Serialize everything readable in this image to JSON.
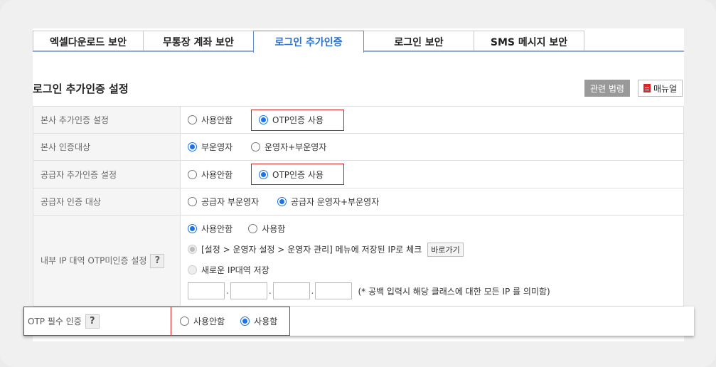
{
  "tabs": [
    {
      "label": "엑셀다운로드 보안",
      "active": false
    },
    {
      "label": "무통장 계좌 보안",
      "active": false
    },
    {
      "label": "로그인 추가인증",
      "active": true
    },
    {
      "label": "로그인 보안",
      "active": false
    },
    {
      "label": "SMS 메시지 보안",
      "active": false
    }
  ],
  "section_title": "로그인 추가인증 설정",
  "buttons": {
    "law": "관련 법령",
    "manual": "매뉴얼"
  },
  "rows": {
    "hq_auth": {
      "label": "본사 추가인증 설정",
      "opt1": "사용안함",
      "opt2": "OTP인증 사용",
      "selected": "opt2"
    },
    "hq_target": {
      "label": "본사 인증대상",
      "opt1": "부운영자",
      "opt2": "운영자+부운영자",
      "selected": "opt1"
    },
    "sup_auth": {
      "label": "공급자 추가인증 설정",
      "opt1": "사용안함",
      "opt2": "OTP인증 사용",
      "selected": "opt2"
    },
    "sup_target": {
      "label": "공급자 인증 대상",
      "opt1": "공급자 부운영자",
      "opt2": "공급자 운영자+부운영자",
      "selected": "opt2"
    },
    "internal_ip": {
      "label": "내부 IP 대역 OTP미인증 설정",
      "opt1": "사용안함",
      "opt2": "사용함",
      "sub1": "[설정 > 운영자 설정 > 운영자 관리] 메뉴에 저장된 IP로 체크",
      "goto": "바로가기",
      "sub2": "새로운 IP대역 저장",
      "ip_note": "(* 공백 입력시 해당 클래스에 대한 모든 IP 를 의미함)"
    },
    "otp_required": {
      "label": "OTP 필수 인증",
      "opt1": "사용안함",
      "opt2": "사용함",
      "selected": "opt2"
    }
  },
  "help_glyph": "?",
  "ip_separator": "."
}
